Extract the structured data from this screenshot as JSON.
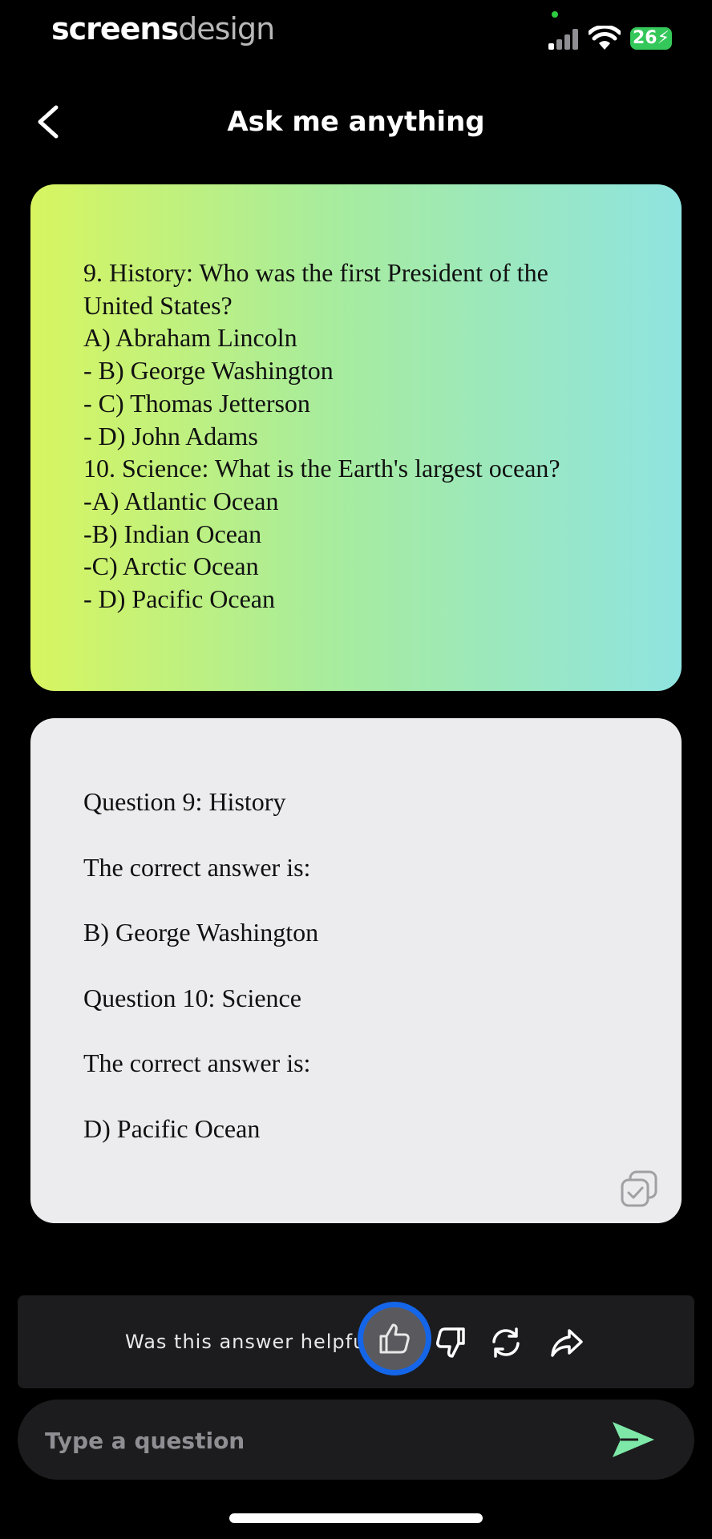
{
  "status_bar": {
    "brand_primary": "screens",
    "brand_secondary": "design",
    "battery": "26"
  },
  "header": {
    "title": "Ask me anything"
  },
  "question_card": {
    "lines": [
      "9. History: Who was the first President of the",
      "United States?",
      "A) Abraham Lincoln",
      "- B) George Washington",
      "- C) Thomas Jetterson",
      "- D) John Adams",
      "10. Science: What is the Earth's largest ocean?",
      "-A) Atlantic Ocean",
      "-B) Indian Ocean",
      "-C) Arctic Ocean",
      "- D) Pacific Ocean"
    ]
  },
  "answer_card": {
    "lines": [
      "Question 9: History",
      "The correct answer is:",
      "B) George Washington",
      "Question 10: Science",
      "The correct answer is:",
      "D) Pacific Ocean"
    ]
  },
  "feedback": {
    "prompt": "Was this answer helpful?"
  },
  "input": {
    "placeholder": "Type a question"
  },
  "icons": {
    "back": "chevron-left-icon",
    "copy": "copy-icon",
    "like": "thumbs-up-icon",
    "dislike": "thumbs-down-icon",
    "regenerate": "refresh-icon",
    "share": "share-icon",
    "send": "send-icon"
  },
  "colors": {
    "accent_blue": "#1565e8",
    "send_green": "#7ee8a8",
    "battery_green": "#34c759"
  }
}
